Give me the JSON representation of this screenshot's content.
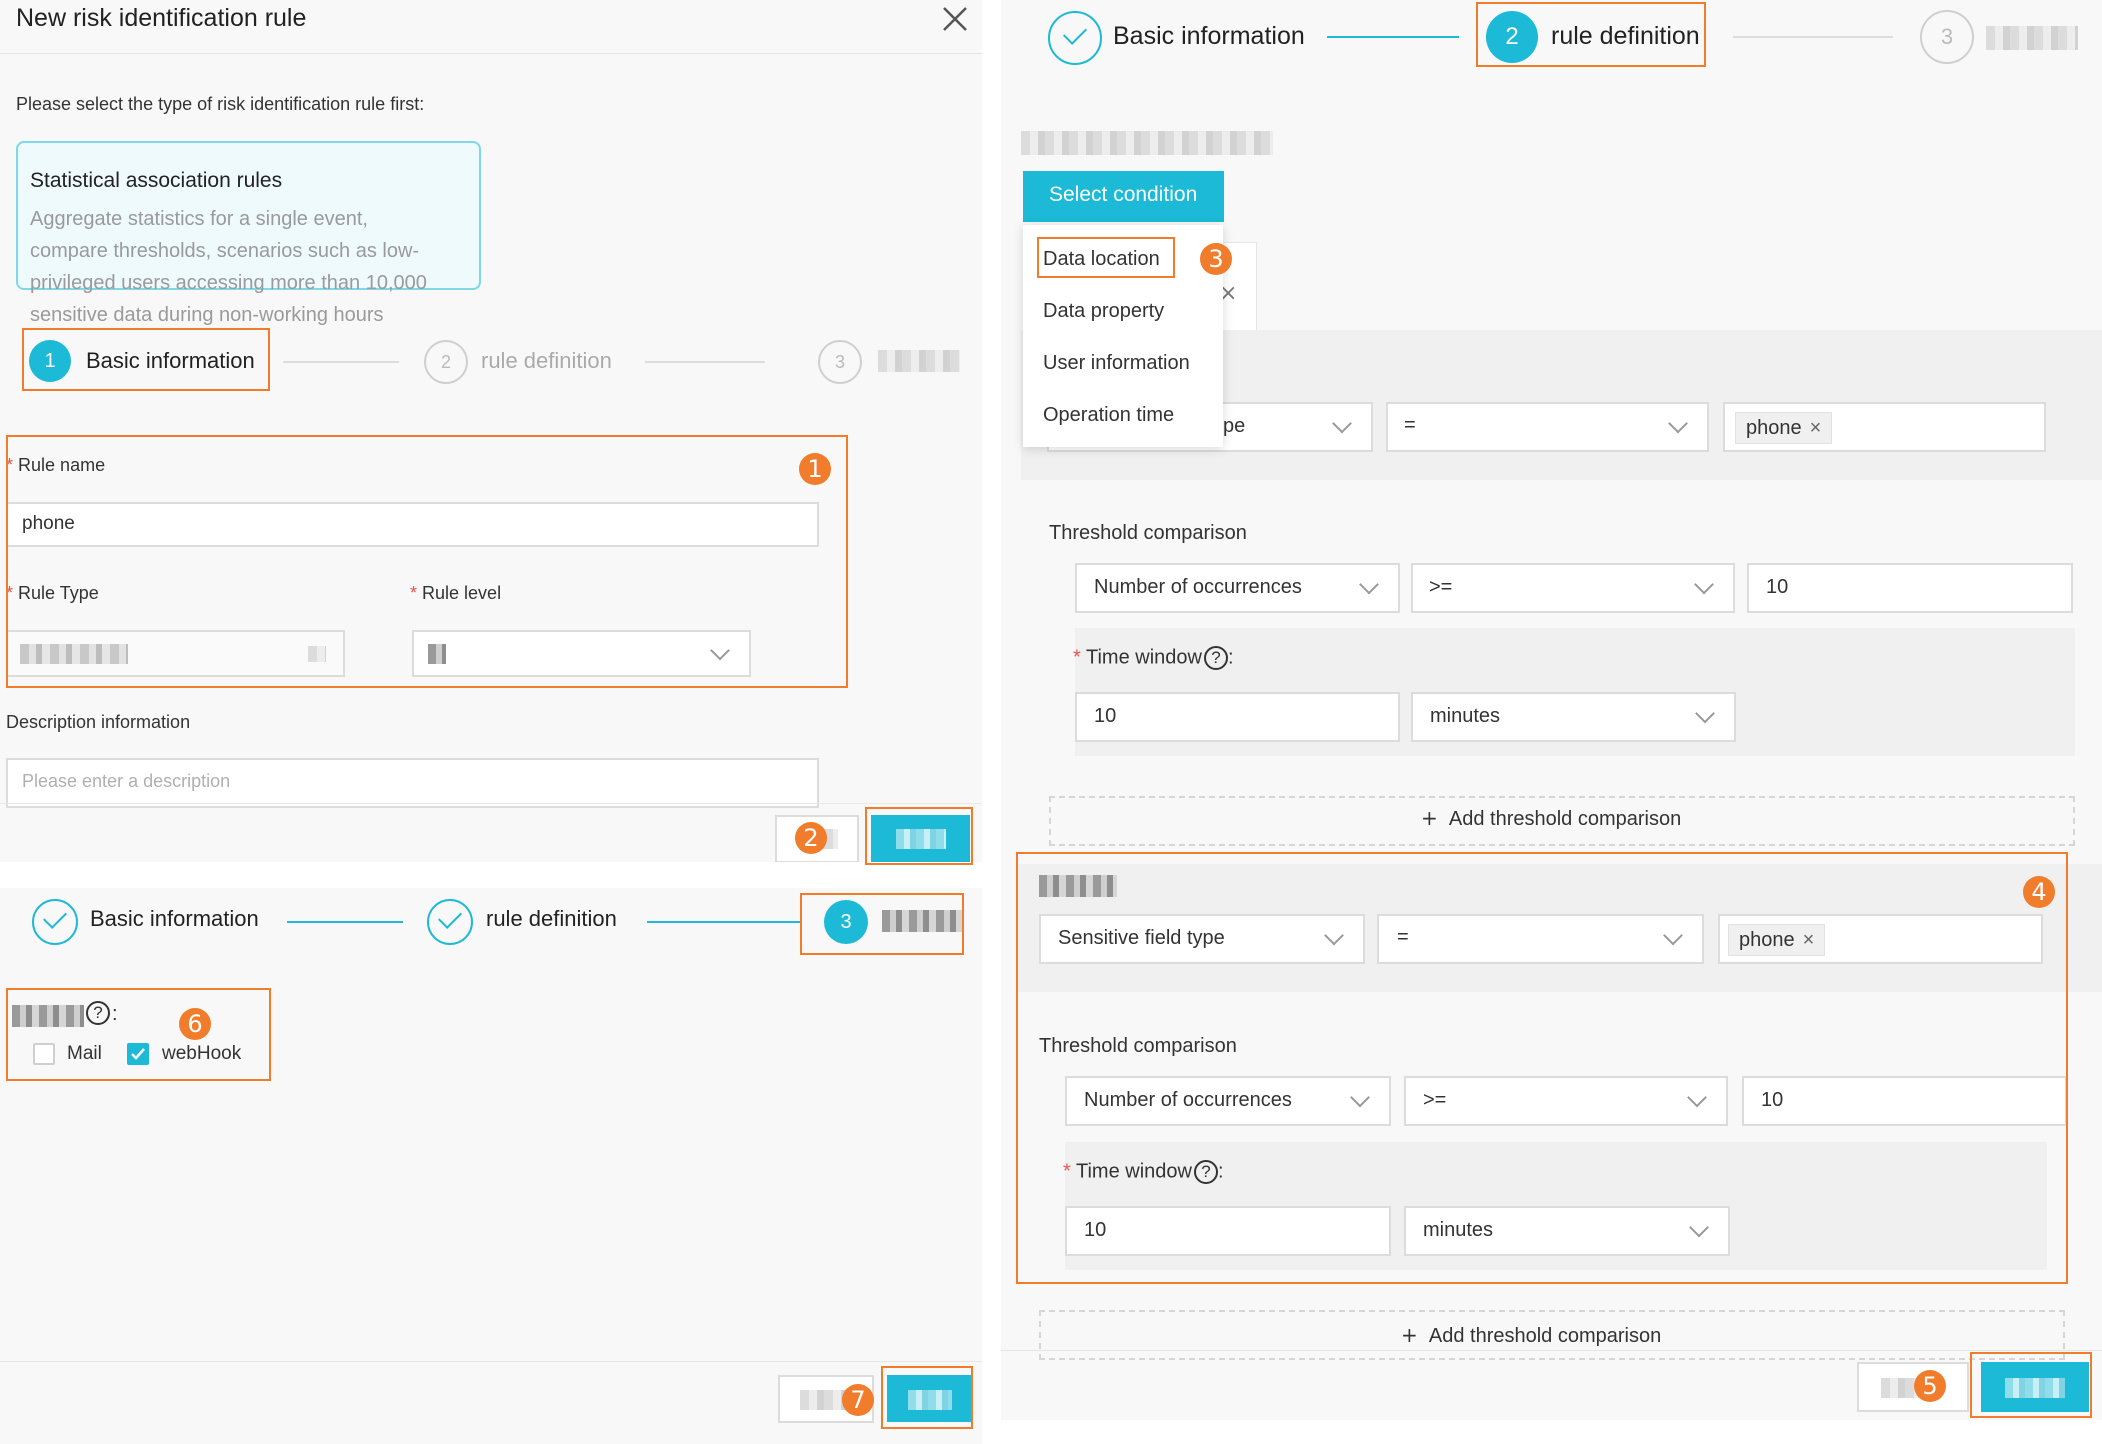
{
  "panel1": {
    "title": "New risk identification rule",
    "prompt": "Please select the type of risk identification rule first:",
    "card_title": "Statistical association rules",
    "card_desc_lines": [
      "Aggregate statistics for a single event,",
      "compare thresholds, scenarios such as low-",
      "privileged users accessing more than 10,000",
      "sensitive data during non-working hours"
    ],
    "steps": [
      {
        "num": "1",
        "label": "Basic information"
      },
      {
        "num": "2",
        "label": "rule definition"
      },
      {
        "num": "3"
      }
    ],
    "rule_name_label": "Rule name",
    "rule_name_value": "phone",
    "rule_type_label": "Rule Type",
    "rule_level_label": "Rule level",
    "description_label": "Description information",
    "description_placeholder": "Please enter a description",
    "required_mark": "*"
  },
  "panel2": {
    "steps": [
      {
        "label": "Basic information"
      },
      {
        "label": "rule definition"
      },
      {
        "num": "3"
      }
    ],
    "question_mark": "?",
    "colon": ":",
    "options": [
      {
        "label": "Mail",
        "checked": false
      },
      {
        "label": "webHook",
        "checked": true
      }
    ]
  },
  "panel3": {
    "steps": [
      {
        "label": "Basic information"
      },
      {
        "num": "2",
        "label": "rule definition"
      },
      {
        "num": "3"
      }
    ],
    "select_condition_button": "Select condition",
    "dropdown_items": [
      "Data location",
      "Data property",
      "User information",
      "Operation time"
    ],
    "close_glyph": "×",
    "field_type_partial": "pe",
    "operator_eq": "=",
    "tag_phone": "phone",
    "tag_close": "×",
    "threshold_label": "Threshold comparison",
    "threshold_metric": "Number of occurrences",
    "threshold_operator": ">=",
    "threshold_value": "10",
    "time_window_label": "Time window",
    "question_mark": "?",
    "colon": ":",
    "time_value": "10",
    "time_unit": "minutes",
    "add_threshold": "Add threshold comparison",
    "plus_glyph": "+",
    "block4": {
      "field_type": "Sensitive field type",
      "operator_eq": "=",
      "tag_phone": "phone",
      "threshold_label": "Threshold comparison",
      "threshold_metric": "Number of occurrences",
      "threshold_operator": ">=",
      "threshold_value": "10",
      "time_window_label": "Time window",
      "time_value": "10",
      "time_unit": "minutes"
    },
    "add_threshold_2": "Add threshold comparison"
  },
  "markers": [
    "1",
    "2",
    "3",
    "4",
    "5",
    "6",
    "7"
  ],
  "colors": {
    "accent": "#1cbad6",
    "highlight": "#f07c2c",
    "required": "#f05050"
  },
  "icons": [
    "close-icon",
    "chevron-down-icon",
    "check-icon",
    "question-circle-icon",
    "plus-icon",
    "tag-close-icon"
  ]
}
